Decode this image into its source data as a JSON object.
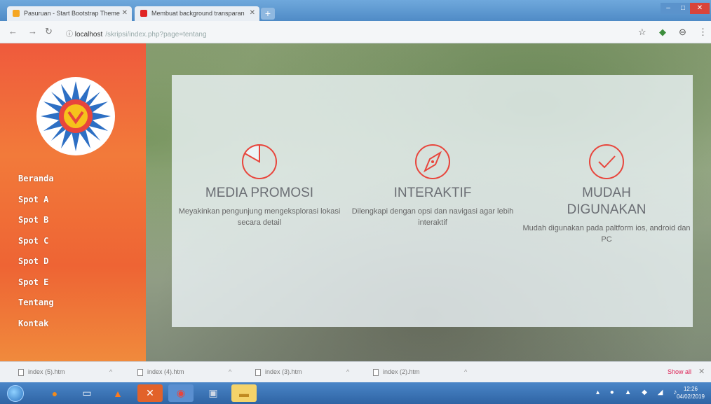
{
  "browser": {
    "tabs": [
      {
        "title": "Pasuruan - Start Bootstrap Theme",
        "favicon_color": "#f5a623"
      },
      {
        "title": "Membuat background transparan",
        "favicon_color": "#e02424"
      }
    ],
    "new_tab_label": "+",
    "address": {
      "host": "localhost",
      "path": "/skripsi/index.php?page=tentang"
    }
  },
  "sidebar": {
    "items": [
      {
        "label": "Beranda"
      },
      {
        "label": "Spot A"
      },
      {
        "label": "Spot B"
      },
      {
        "label": "Spot C"
      },
      {
        "label": "Spot D"
      },
      {
        "label": "Spot E"
      },
      {
        "label": "Tentang"
      },
      {
        "label": "Kontak"
      }
    ]
  },
  "features": [
    {
      "icon": "pie-chart-icon",
      "title": "MEDIA PROMOSI",
      "text": "Meyakinkan pengunjung mengeksplorasi lokasi secara detail"
    },
    {
      "icon": "compass-icon",
      "title": "INTERAKTIF",
      "text": "Dilengkapi dengan opsi dan navigasi agar lebih interaktif"
    },
    {
      "icon": "check-circle-icon",
      "title": "MUDAH DIGUNAKAN",
      "text": "Mudah digunakan pada paltform ios, android dan PC"
    }
  ],
  "downloads": {
    "items": [
      {
        "name": "index (5).htm"
      },
      {
        "name": "index (4).htm"
      },
      {
        "name": "index (3).htm"
      },
      {
        "name": "index (2).htm"
      }
    ],
    "show_all": "Show all"
  },
  "taskbar": {
    "time": "12:26",
    "date": "04/02/2019"
  },
  "colors": {
    "sidebar": "#ef5a3c",
    "accent": "#e8453c",
    "panel": "#ecf4f7"
  }
}
